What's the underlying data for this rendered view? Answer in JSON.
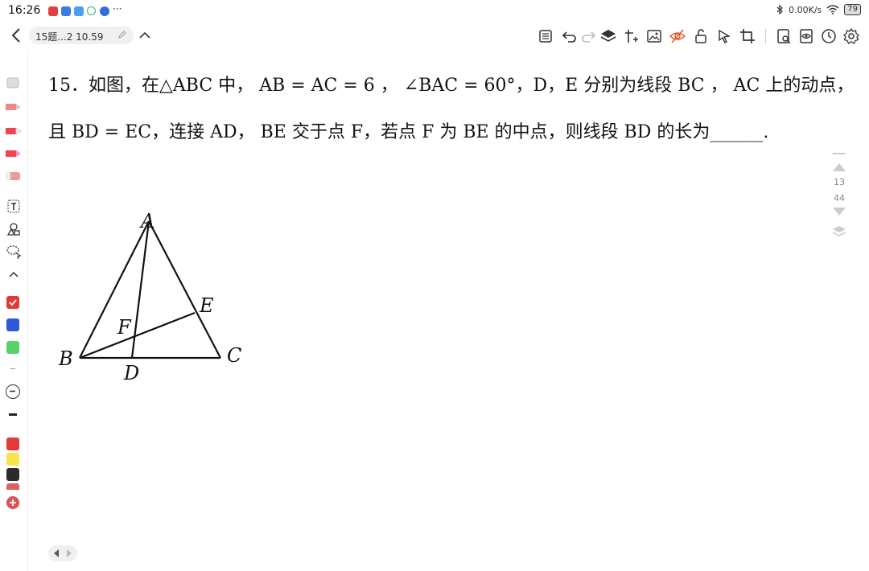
{
  "status_bar": {
    "time": "16:26",
    "more": "···",
    "network_speed": "0.00K/s",
    "battery": "79",
    "icons": [
      "bluetooth-icon",
      "wifi-icon",
      "battery-icon"
    ]
  },
  "toolbar": {
    "doc_title": "15题...2 10.59",
    "icons": [
      "outline-icon",
      "undo-icon",
      "redo-icon",
      "layers-icon",
      "insert-icon",
      "image-icon",
      "hide-icon",
      "lock-icon",
      "pointer-icon",
      "crop-icon",
      "search-doc-icon",
      "view-icon",
      "history-icon",
      "settings-icon"
    ]
  },
  "left_rail": {
    "tools": [
      "eraser-icon",
      "pen-icon",
      "pencil-icon",
      "marker-icon",
      "highlighter-icon",
      "text-icon",
      "shapes-icon",
      "lasso-icon",
      "collapse-icon"
    ],
    "colors": [
      "#e53935",
      "#2f57d8",
      "#5ad26b",
      "#e53935",
      "#f7e34b",
      "#2b2b2b",
      "#e06060"
    ]
  },
  "problem": {
    "line1": "15．如图，在△ABC 中， AB = AC = 6 ， ∠BAC = 60°，D，E 分别为线段 BC ， AC 上的动点，",
    "line2": "且 BD = EC，连接 AD， BE 交于点 F，若点 F 为 BE 的中点，则线段 BD 的长为______."
  },
  "figure": {
    "labels": {
      "A": "A",
      "B": "B",
      "C": "C",
      "D": "D",
      "E": "E",
      "F": "F"
    }
  },
  "page_indicator": {
    "current": "13",
    "total": "44"
  }
}
